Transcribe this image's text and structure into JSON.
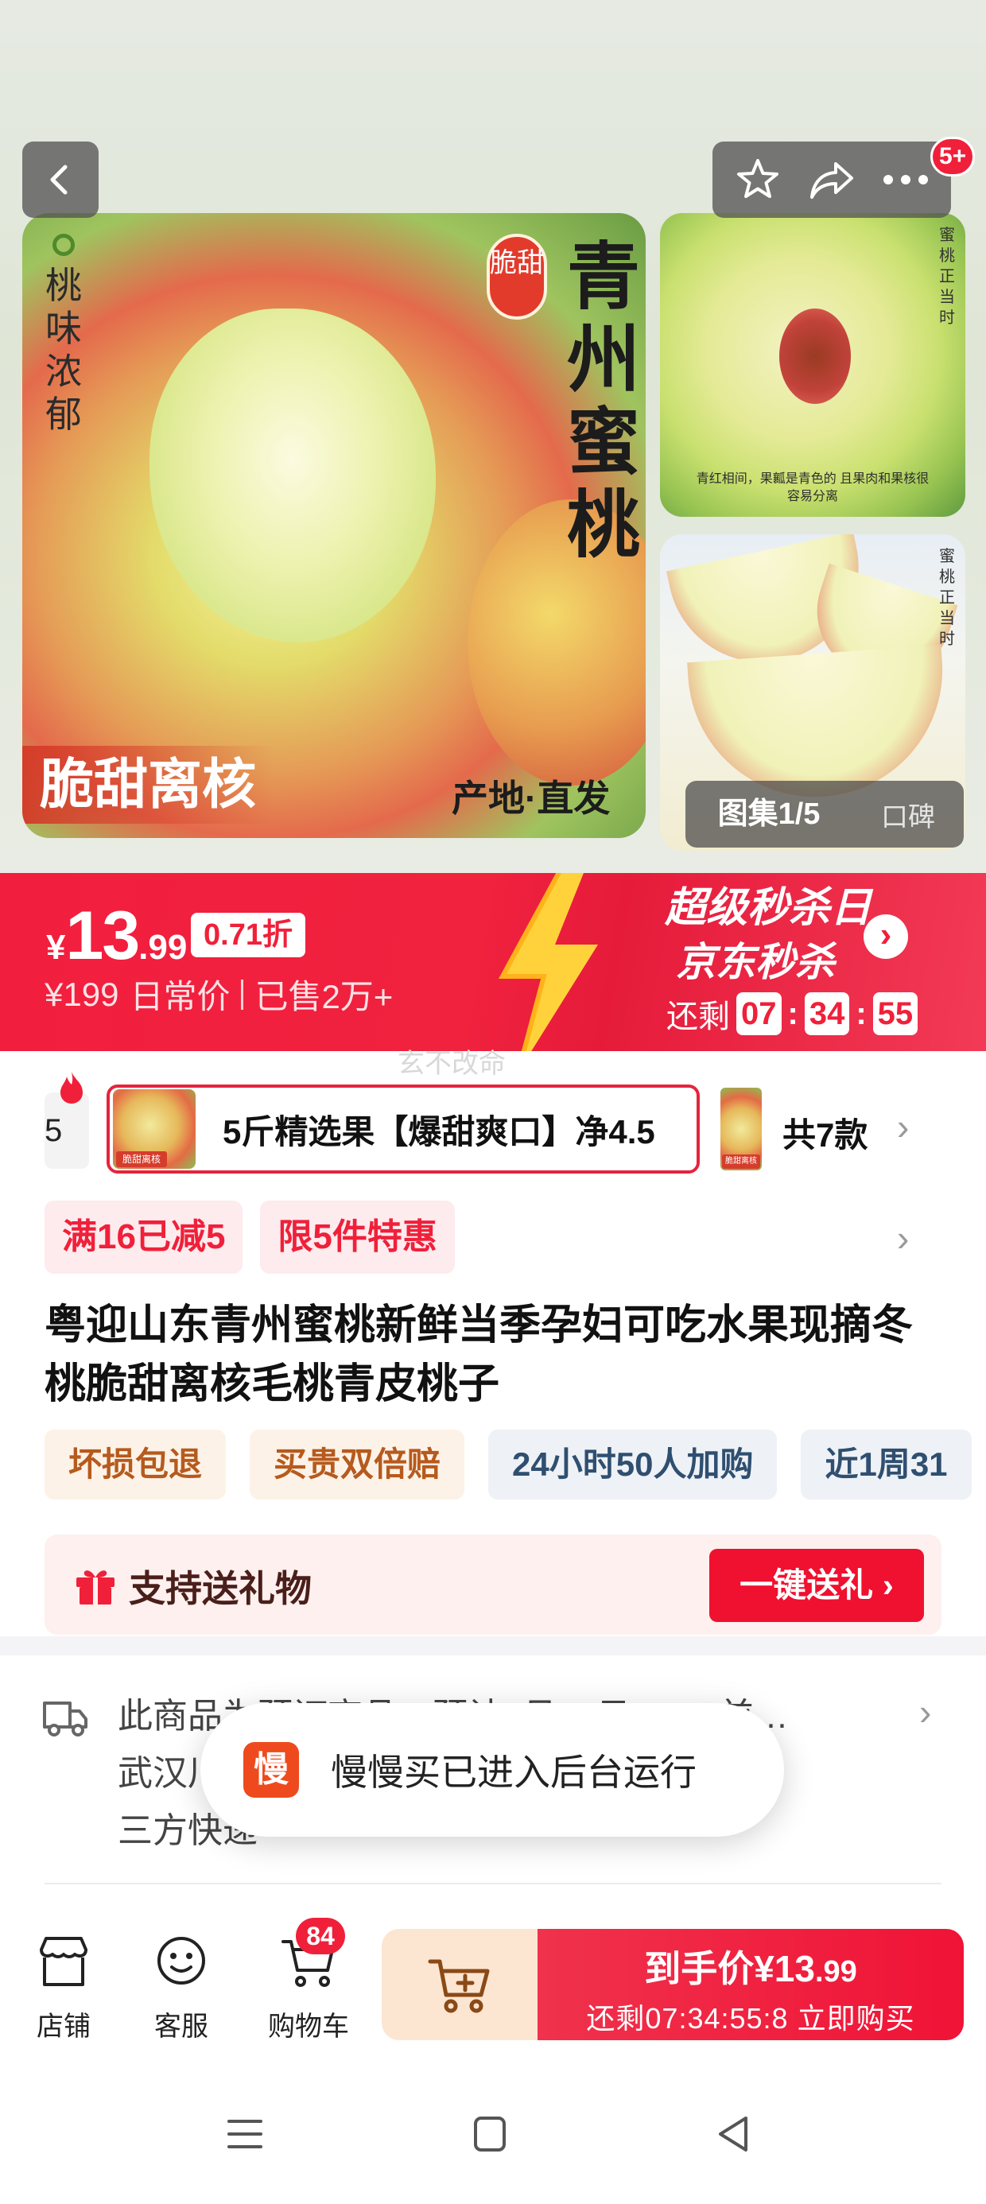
{
  "gallery": {
    "main_image": {
      "vertical_left_text": "桃味浓郁",
      "crisp_tag": "脆甜",
      "title_vertical": "青州蜜桃",
      "slogan_left": "脆甜离核",
      "slogan_right": "产地·直发"
    },
    "thumb1_caption": "青红相间，果瓤是青色的 且果肉和果核很容易分离",
    "thumb1_vertical": "蜜桃正当时",
    "thumb2_vertical": "蜜桃正当时",
    "counter": "图集1/5",
    "reputation_label": "口碑",
    "message_badge": "5+"
  },
  "price": {
    "currency": "¥",
    "integer": "13",
    "decimal": ".99",
    "discount": "0.71折",
    "original_price": "¥199",
    "original_label": "日常价",
    "sold": "已售2万+",
    "flash_title": "超级秒杀日",
    "flash_sub": "京东秒杀",
    "countdown_label": "还剩",
    "countdown_h": "07",
    "countdown_m": "34",
    "countdown_s": "55"
  },
  "watermark": "玄不改命",
  "variants": {
    "edge_text": "5",
    "selected_label": "5斤精选果【爆甜爽口】净4.5",
    "thumb_label": "脆甜离核",
    "total": "共7款"
  },
  "promos": [
    "满16已减5",
    "限5件特惠"
  ],
  "title": "粤迎山东青州蜜桃新鲜当季孕妇可吃水果现摘冬桃脆甜离核毛桃青皮桃子",
  "services": [
    {
      "label": "坏损包退",
      "tone": "warm"
    },
    {
      "label": "买贵双倍赔",
      "tone": "warm"
    },
    {
      "label": "24小时50人加购",
      "tone": "cool"
    },
    {
      "label": "近1周31",
      "tone": "cool"
    }
  ],
  "gift": {
    "label": "支持送礼物",
    "button": "一键送礼 ›"
  },
  "delivery": {
    "line1": "此商品为预订商品，预计9月26日24:00前…",
    "line2": "武汉川",
    "line3": "三方快递"
  },
  "toast": {
    "icon_char": "慢",
    "text": "慢慢买已进入后台运行"
  },
  "bottom_bar": {
    "shop": "店铺",
    "service": "客服",
    "cart": "购物车",
    "cart_count": "84",
    "buy_line1_prefix": "到手价",
    "buy_price_int": "¥13",
    "buy_price_dec": ".99",
    "buy_line2": "还剩07:34:55:8  立即购买"
  },
  "colors": {
    "accent": "#f0203a",
    "price_banner": "#f21e3e",
    "add_cart_bg": "#fce6d2"
  }
}
